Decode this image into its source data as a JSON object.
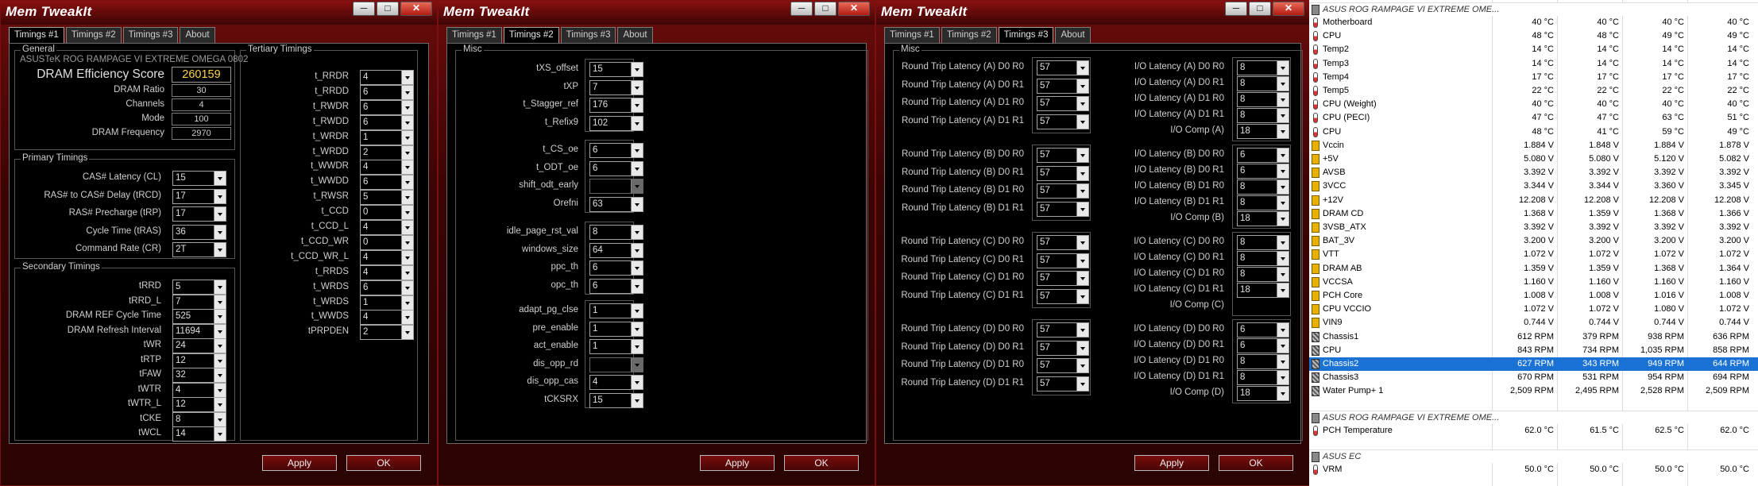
{
  "window_title": "Mem TweakIt",
  "window_controls": {
    "minimize": "─",
    "restore": "□",
    "close": "✕"
  },
  "tabs": [
    "Timings #1",
    "Timings #2",
    "Timings #3",
    "About"
  ],
  "buttons": {
    "apply": "Apply",
    "ok": "OK"
  },
  "win1": {
    "general": {
      "title": "General",
      "board": "ASUSTeK ROG RAMPAGE VI EXTREME OMEGA 0802",
      "score_label": "DRAM Efficiency Score",
      "score": "260159",
      "fields": [
        {
          "label": "DRAM Ratio",
          "value": "30"
        },
        {
          "label": "Channels",
          "value": "4"
        },
        {
          "label": "Mode",
          "value": "100"
        },
        {
          "label": "DRAM Frequency",
          "value": "2970"
        }
      ]
    },
    "primary": {
      "title": "Primary Timings",
      "items": [
        {
          "label": "CAS# Latency (CL)",
          "value": "15"
        },
        {
          "label": "RAS# to CAS# Delay (tRCD)",
          "value": "17"
        },
        {
          "label": "RAS# Precharge (tRP)",
          "value": "17"
        },
        {
          "label": "Cycle Time (tRAS)",
          "value": "36"
        },
        {
          "label": "Command Rate (CR)",
          "value": "2T"
        }
      ]
    },
    "secondary": {
      "title": "Secondary Timings",
      "items": [
        {
          "label": "tRRD",
          "value": "5"
        },
        {
          "label": "tRRD_L",
          "value": "7"
        },
        {
          "label": "DRAM REF Cycle Time",
          "value": "525"
        },
        {
          "label": "DRAM Refresh Interval",
          "value": "11694"
        },
        {
          "label": "tWR",
          "value": "24"
        },
        {
          "label": "tRTP",
          "value": "12"
        },
        {
          "label": "tFAW",
          "value": "32"
        },
        {
          "label": "tWTR",
          "value": "4"
        },
        {
          "label": "tWTR_L",
          "value": "12"
        },
        {
          "label": "tCKE",
          "value": "8"
        },
        {
          "label": "tWCL",
          "value": "14"
        }
      ]
    },
    "tertiary": {
      "title": "Tertiary Timings",
      "items": [
        {
          "label": "t_RRDR",
          "value": "4"
        },
        {
          "label": "t_RRDD",
          "value": "6"
        },
        {
          "label": "t_RWDR",
          "value": "6"
        },
        {
          "label": "t_RWDD",
          "value": "6"
        },
        {
          "label": "t_WRDR",
          "value": "1"
        },
        {
          "label": "t_WRDD",
          "value": "2"
        },
        {
          "label": "t_WWDR",
          "value": "4"
        },
        {
          "label": "t_WWDD",
          "value": "6"
        },
        {
          "label": "t_RWSR",
          "value": "5"
        },
        {
          "label": "t_CCD",
          "value": "0"
        },
        {
          "label": "t_CCD_L",
          "value": "4"
        },
        {
          "label": "t_CCD_WR",
          "value": "0"
        },
        {
          "label": "t_CCD_WR_L",
          "value": "4"
        },
        {
          "label": "t_RRDS",
          "value": "4"
        },
        {
          "label": "t_WRDS",
          "value": "6"
        },
        {
          "label": "t_WRDS",
          "value": "1"
        },
        {
          "label": "t_WWDS",
          "value": "4"
        },
        {
          "label": "tPRPDEN",
          "value": "2"
        }
      ]
    }
  },
  "win2": {
    "misc_title": "Misc",
    "groups": [
      [
        {
          "label": "tXS_offset",
          "value": "15"
        },
        {
          "label": "tXP",
          "value": "7"
        },
        {
          "label": "t_Stagger_ref",
          "value": "176"
        },
        {
          "label": "t_Refix9",
          "value": "102"
        }
      ],
      [
        {
          "label": "t_CS_oe",
          "value": "6"
        },
        {
          "label": "t_ODT_oe",
          "value": "6"
        },
        {
          "label": "shift_odt_early",
          "value": ""
        },
        {
          "label": "Orefni",
          "value": "63"
        }
      ],
      [
        {
          "label": "idle_page_rst_val",
          "value": "8"
        },
        {
          "label": "windows_size",
          "value": "64"
        },
        {
          "label": "ppc_th",
          "value": "6"
        },
        {
          "label": "opc_th",
          "value": "6"
        }
      ],
      [
        {
          "label": "adapt_pg_clse",
          "value": "1"
        },
        {
          "label": "pre_enable",
          "value": "1"
        },
        {
          "label": "act_enable",
          "value": "1"
        },
        {
          "label": "dis_opp_rd",
          "value": ""
        },
        {
          "label": "dis_opp_cas",
          "value": "4"
        },
        {
          "label": "tCKSRX",
          "value": "15"
        }
      ]
    ]
  },
  "win3": {
    "misc_title": "Misc",
    "blocks": [
      {
        "rt": [
          {
            "label": "Round Trip Latency (A) D0 R0",
            "value": "57"
          },
          {
            "label": "Round Trip Latency (A) D0 R1",
            "value": "57"
          },
          {
            "label": "Round Trip Latency (A) D1 R0",
            "value": "57"
          },
          {
            "label": "Round Trip Latency (A) D1 R1",
            "value": "57"
          }
        ],
        "io": [
          {
            "label": "I/O Latency (A) D0 R0",
            "value": "8"
          },
          {
            "label": "I/O Latency (A) D0 R1",
            "value": "8"
          },
          {
            "label": "I/O Latency (A) D1 R0",
            "value": "8"
          },
          {
            "label": "I/O Latency (A) D1 R1",
            "value": "8"
          },
          {
            "label": "I/O Comp (A)",
            "value": "18"
          }
        ]
      },
      {
        "rt": [
          {
            "label": "Round Trip Latency (B) D0 R0",
            "value": "57"
          },
          {
            "label": "Round Trip Latency (B) D0 R1",
            "value": "57"
          },
          {
            "label": "Round Trip Latency (B) D1 R0",
            "value": "57"
          },
          {
            "label": "Round Trip Latency (B) D1 R1",
            "value": "57"
          }
        ],
        "io": [
          {
            "label": "I/O Latency (B) D0 R0",
            "value": "6"
          },
          {
            "label": "I/O Latency (B) D0 R1",
            "value": "6"
          },
          {
            "label": "I/O Latency (B) D1 R0",
            "value": "8"
          },
          {
            "label": "I/O Latency (B) D1 R1",
            "value": "8"
          },
          {
            "label": "I/O Comp (B)",
            "value": "18"
          }
        ]
      },
      {
        "rt": [
          {
            "label": "Round Trip Latency (C) D0 R0",
            "value": "57"
          },
          {
            "label": "Round Trip Latency (C) D0 R1",
            "value": "57"
          },
          {
            "label": "Round Trip Latency (C) D1 R0",
            "value": "57"
          },
          {
            "label": "Round Trip Latency (C) D1 R1",
            "value": "57"
          }
        ],
        "io": [
          {
            "label": "I/O Latency (C) D0 R0",
            "value": "8"
          },
          {
            "label": "I/O Latency (C) D0 R1",
            "value": "8"
          },
          {
            "label": "I/O Latency (C) D1 R0",
            "value": "8"
          },
          {
            "label": "I/O Latency (C) D1 R1",
            "value": "18"
          },
          {
            "label": "I/O Comp (C)",
            "value": ""
          }
        ]
      },
      {
        "rt": [
          {
            "label": "Round Trip Latency (D) D0 R0",
            "value": "57"
          },
          {
            "label": "Round Trip Latency (D) D0 R1",
            "value": "57"
          },
          {
            "label": "Round Trip Latency (D) D1 R0",
            "value": "57"
          },
          {
            "label": "Round Trip Latency (D) D1 R1",
            "value": "57"
          }
        ],
        "io": [
          {
            "label": "I/O Latency (D) D0 R0",
            "value": "6"
          },
          {
            "label": "I/O Latency (D) D0 R1",
            "value": "6"
          },
          {
            "label": "I/O Latency (D) D1 R0",
            "value": "8"
          },
          {
            "label": "I/O Latency (D) D1 R1",
            "value": "8"
          },
          {
            "label": "I/O Comp (D)",
            "value": "18"
          }
        ]
      }
    ]
  },
  "hwinfo": {
    "sections": [
      {
        "title": "ASUS ROG RAMPAGE VI EXTREME OME...",
        "rows": [
          {
            "icon": "thermometer-icon",
            "name": "Motherboard",
            "v": [
              "40 °C",
              "40 °C",
              "40 °C",
              "40 °C"
            ]
          },
          {
            "icon": "thermometer-icon",
            "name": "CPU",
            "v": [
              "48 °C",
              "48 °C",
              "49 °C",
              "49 °C"
            ]
          },
          {
            "icon": "thermometer-icon",
            "name": "Temp2",
            "v": [
              "14 °C",
              "14 °C",
              "14 °C",
              "14 °C"
            ]
          },
          {
            "icon": "thermometer-icon",
            "name": "Temp3",
            "v": [
              "14 °C",
              "14 °C",
              "14 °C",
              "14 °C"
            ]
          },
          {
            "icon": "thermometer-icon",
            "name": "Temp4",
            "v": [
              "17 °C",
              "17 °C",
              "17 °C",
              "17 °C"
            ]
          },
          {
            "icon": "thermometer-icon",
            "name": "Temp5",
            "v": [
              "22 °C",
              "22 °C",
              "22 °C",
              "22 °C"
            ]
          },
          {
            "icon": "thermometer-icon",
            "name": "CPU (Weight)",
            "v": [
              "40 °C",
              "40 °C",
              "40 °C",
              "40 °C"
            ]
          },
          {
            "icon": "thermometer-icon",
            "name": "CPU (PECI)",
            "v": [
              "47 °C",
              "47 °C",
              "63 °C",
              "51 °C"
            ]
          },
          {
            "icon": "thermometer-icon",
            "name": "CPU",
            "v": [
              "48 °C",
              "41 °C",
              "59 °C",
              "49 °C"
            ]
          },
          {
            "icon": "voltage-icon",
            "name": "Vccin",
            "v": [
              "1.884 V",
              "1.848 V",
              "1.884 V",
              "1.878 V"
            ]
          },
          {
            "icon": "voltage-icon",
            "name": "+5V",
            "v": [
              "5.080 V",
              "5.080 V",
              "5.120 V",
              "5.082 V"
            ]
          },
          {
            "icon": "voltage-icon",
            "name": "AVSB",
            "v": [
              "3.392 V",
              "3.392 V",
              "3.392 V",
              "3.392 V"
            ]
          },
          {
            "icon": "voltage-icon",
            "name": "3VCC",
            "v": [
              "3.344 V",
              "3.344 V",
              "3.360 V",
              "3.345 V"
            ]
          },
          {
            "icon": "voltage-icon",
            "name": "+12V",
            "v": [
              "12.208 V",
              "12.208 V",
              "12.208 V",
              "12.208 V"
            ]
          },
          {
            "icon": "voltage-icon",
            "name": "DRAM CD",
            "v": [
              "1.368 V",
              "1.359 V",
              "1.368 V",
              "1.366 V"
            ]
          },
          {
            "icon": "voltage-icon",
            "name": "3VSB_ATX",
            "v": [
              "3.392 V",
              "3.392 V",
              "3.392 V",
              "3.392 V"
            ]
          },
          {
            "icon": "voltage-icon",
            "name": "BAT_3V",
            "v": [
              "3.200 V",
              "3.200 V",
              "3.200 V",
              "3.200 V"
            ]
          },
          {
            "icon": "voltage-icon",
            "name": "VTT",
            "v": [
              "1.072 V",
              "1.072 V",
              "1.072 V",
              "1.072 V"
            ]
          },
          {
            "icon": "voltage-icon",
            "name": "DRAM AB",
            "v": [
              "1.359 V",
              "1.359 V",
              "1.368 V",
              "1.364 V"
            ]
          },
          {
            "icon": "voltage-icon",
            "name": "VCCSA",
            "v": [
              "1.160 V",
              "1.160 V",
              "1.160 V",
              "1.160 V"
            ]
          },
          {
            "icon": "voltage-icon",
            "name": "PCH Core",
            "v": [
              "1.008 V",
              "1.008 V",
              "1.016 V",
              "1.008 V"
            ]
          },
          {
            "icon": "voltage-icon",
            "name": "CPU VCCIO",
            "v": [
              "1.072 V",
              "1.072 V",
              "1.080 V",
              "1.072 V"
            ]
          },
          {
            "icon": "voltage-icon",
            "name": "VIN9",
            "v": [
              "0.744 V",
              "0.744 V",
              "0.744 V",
              "0.744 V"
            ]
          },
          {
            "icon": "fan-icon",
            "name": "Chassis1",
            "v": [
              "612 RPM",
              "379 RPM",
              "938 RPM",
              "636 RPM"
            ]
          },
          {
            "icon": "fan-icon",
            "name": "CPU",
            "v": [
              "843 RPM",
              "734 RPM",
              "1,035 RPM",
              "858 RPM"
            ]
          },
          {
            "icon": "fan-icon",
            "name": "Chassis2",
            "v": [
              "627 RPM",
              "343 RPM",
              "949 RPM",
              "644 RPM"
            ],
            "selected": true
          },
          {
            "icon": "fan-icon",
            "name": "Chassis3",
            "v": [
              "670 RPM",
              "531 RPM",
              "954 RPM",
              "694 RPM"
            ]
          },
          {
            "icon": "fan-icon",
            "name": "Water Pump+ 1",
            "v": [
              "2,509 RPM",
              "2,495 RPM",
              "2,528 RPM",
              "2,509 RPM"
            ]
          }
        ]
      },
      {
        "title": "ASUS ROG RAMPAGE VI EXTREME OME...",
        "rows": [
          {
            "icon": "thermometer-icon",
            "name": "PCH Temperature",
            "v": [
              "62.0 °C",
              "61.5 °C",
              "62.5 °C",
              "62.0 °C"
            ]
          }
        ]
      },
      {
        "title": "ASUS EC",
        "rows": [
          {
            "icon": "thermometer-icon",
            "name": "VRM",
            "v": [
              "50.0 °C",
              "50.0 °C",
              "50.0 °C",
              "50.0 °C"
            ]
          }
        ]
      }
    ]
  }
}
